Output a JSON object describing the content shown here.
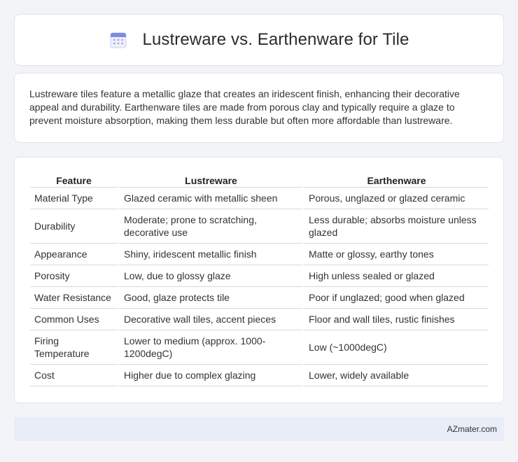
{
  "header": {
    "title": "Lustreware vs. Earthenware for Tile",
    "icon": "calendar-icon"
  },
  "description": "Lustreware tiles feature a metallic glaze that creates an iridescent finish, enhancing their decorative appeal and durability. Earthenware tiles are made from porous clay and typically require a glaze to prevent moisture absorption, making them less durable but often more affordable than lustreware.",
  "table": {
    "columns": [
      "Feature",
      "Lustreware",
      "Earthenware"
    ],
    "rows": [
      [
        "Material Type",
        "Glazed ceramic with metallic sheen",
        "Porous, unglazed or glazed ceramic"
      ],
      [
        "Durability",
        "Moderate; prone to scratching, decorative use",
        "Less durable; absorbs moisture unless glazed"
      ],
      [
        "Appearance",
        "Shiny, iridescent metallic finish",
        "Matte or glossy, earthy tones"
      ],
      [
        "Porosity",
        "Low, due to glossy glaze",
        "High unless sealed or glazed"
      ],
      [
        "Water Resistance",
        "Good, glaze protects tile",
        "Poor if unglazed; good when glazed"
      ],
      [
        "Common Uses",
        "Decorative wall tiles, accent pieces",
        "Floor and wall tiles, rustic finishes"
      ],
      [
        "Firing Temperature",
        "Lower to medium (approx. 1000-1200degC)",
        "Low (~1000degC)"
      ],
      [
        "Cost",
        "Higher due to complex glazing",
        "Lower, widely available"
      ]
    ]
  },
  "footer": {
    "brand": "AZmater.com"
  },
  "colors": {
    "background": "#f3f4f8",
    "card": "#ffffff",
    "footer": "#e8edf7",
    "icon_accent": "#7b8be0"
  }
}
